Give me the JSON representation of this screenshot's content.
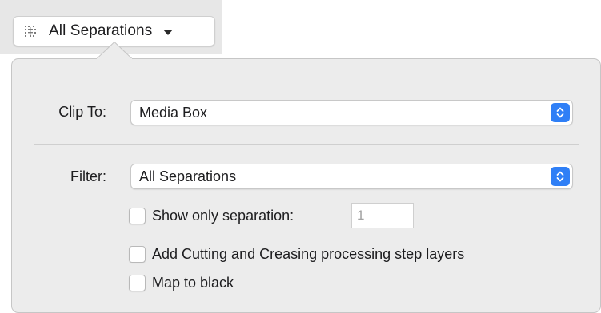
{
  "toolbar": {
    "separations_button_label": "All Separations",
    "separations_icon": "separations-grid-icon",
    "caret_icon": "caret-down-icon"
  },
  "panel": {
    "clip_to": {
      "label": "Clip To:",
      "selected": "Media Box"
    },
    "filter": {
      "label": "Filter:",
      "selected": "All Separations"
    },
    "show_only_separation": {
      "label": "Show only separation:",
      "checked": false,
      "value": "1"
    },
    "add_cutting_creasing": {
      "label": "Add Cutting and Creasing processing step layers",
      "checked": false
    },
    "map_to_black": {
      "label": "Map to black",
      "checked": false
    }
  },
  "colors": {
    "accent": "#2f7ff6",
    "panel_bg": "#ececec",
    "toolbar_bg": "#e7e7e7"
  }
}
